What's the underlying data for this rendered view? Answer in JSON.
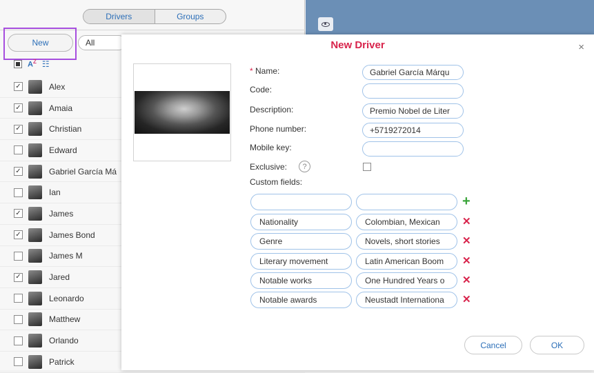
{
  "left_panel": {
    "tabs": [
      {
        "label": "Drivers",
        "active": true
      },
      {
        "label": "Groups",
        "active": false
      }
    ],
    "new_label": "New",
    "filter_value": "All",
    "drivers": [
      {
        "name": "Alex",
        "checked": true
      },
      {
        "name": "Amaia",
        "checked": true
      },
      {
        "name": "Christian",
        "checked": true
      },
      {
        "name": "Edward",
        "checked": false
      },
      {
        "name": "Gabriel García Má",
        "checked": true
      },
      {
        "name": "Ian",
        "checked": false
      },
      {
        "name": "James",
        "checked": true
      },
      {
        "name": "James Bond",
        "checked": true
      },
      {
        "name": "James M",
        "checked": false
      },
      {
        "name": "Jared",
        "checked": true
      },
      {
        "name": "Leonardo",
        "checked": false
      },
      {
        "name": "Matthew",
        "checked": false
      },
      {
        "name": "Orlando",
        "checked": false
      },
      {
        "name": "Patrick",
        "checked": false
      }
    ]
  },
  "modal": {
    "title": "New Driver",
    "close": "×",
    "required_mark": "*",
    "labels": {
      "name": "Name:",
      "code": "Code:",
      "description": "Description:",
      "phone": "Phone number:",
      "mobile_key": "Mobile key:",
      "exclusive": "Exclusive:",
      "custom_fields": "Custom fields:"
    },
    "help_glyph": "?",
    "values": {
      "name": "Gabriel García Márqu",
      "code": "",
      "description": "Premio Nobel de Liter",
      "phone": "+5719272014",
      "mobile_key": ""
    },
    "custom_fields": [
      {
        "key": "Nationality",
        "value": "Colombian, Mexican"
      },
      {
        "key": "Genre",
        "value": "Novels, short stories"
      },
      {
        "key": "Literary movement",
        "value": "Latin American Boom"
      },
      {
        "key": "Notable works",
        "value": "One Hundred Years o"
      },
      {
        "key": "Notable awards",
        "value": "Neustadt Internationa"
      }
    ],
    "cancel_label": "Cancel",
    "ok_label": "OK"
  },
  "colors": {
    "title_red": "#d8234b",
    "link_blue": "#2c6fb8",
    "add_green": "#3aa43a",
    "highlight_purple": "#a64dde",
    "backdrop_blue": "#6b8fb6"
  }
}
